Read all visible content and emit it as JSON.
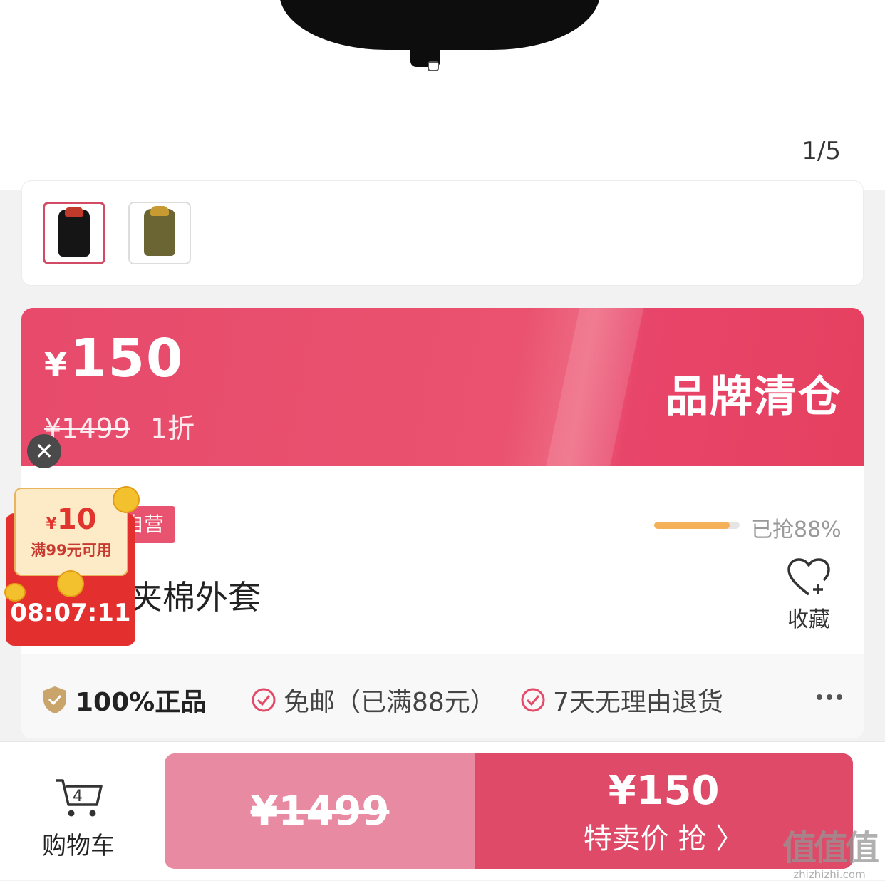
{
  "gallery": {
    "page_indicator": "1/5"
  },
  "thumbnails": [
    {
      "name": "black",
      "color": "#151515",
      "hood_color": "#c0392b",
      "selected": true
    },
    {
      "name": "olive",
      "color": "#6b6533",
      "hood_color": "#c79a32",
      "selected": false
    }
  ],
  "price_banner": {
    "currency": "¥",
    "price": "150",
    "original_price": "¥1499",
    "discount": "1折",
    "tag": "品牌清仓"
  },
  "product": {
    "badge": "自营",
    "sold_progress_label": "已抢88%",
    "sold_progress": 0.88,
    "title": "男装夹棉外套",
    "favorite_label": "收藏"
  },
  "guarantees": [
    {
      "icon": "shield-icon",
      "label": "100%正品"
    },
    {
      "icon": "check-circle-icon",
      "label": "免邮（已满88元）"
    },
    {
      "icon": "check-circle-icon",
      "label": "7天无理由退货"
    }
  ],
  "bottom_bar": {
    "cart_label": "购物车",
    "cart_count": "4",
    "original_price_button": "¥1499",
    "buy_price": "¥150",
    "buy_label": "特卖价 抢 〉"
  },
  "coupon": {
    "currency": "¥",
    "amount": "10",
    "condition": "满99元可用",
    "countdown": "08:07:11",
    "close": "✕"
  },
  "watermark": {
    "logo": "值值值",
    "domain": "zhizhizhi.com"
  },
  "colors": {
    "brand": "#e74a6b",
    "progress": "#f4b15a",
    "coupon_red": "#e42f2f"
  }
}
